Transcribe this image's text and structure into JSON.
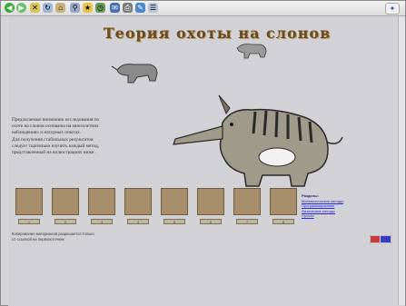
{
  "toolbar": {
    "icons": [
      "back-icon",
      "forward-icon",
      "stop-icon",
      "refresh-icon",
      "home-icon",
      "search-icon",
      "favorites-icon",
      "history-icon",
      "mail-icon",
      "print-icon",
      "edit-icon",
      "discuss-icon",
      "browser-logo-icon"
    ]
  },
  "page": {
    "title": "Теория охоты на слонов",
    "paragraph": [
      "Предлагаемые вниманию исследования по",
      "охоте на слонов основаны на многолетних",
      "наблюдениях и натурных опытах.",
      "Для получения стабильных результатов",
      "следует тщательно изучить каждый метод,",
      "представленный на иллюстрациях ниже."
    ],
    "thumbnails": [
      {
        "caption": "1"
      },
      {
        "caption": "2"
      },
      {
        "caption": "3"
      },
      {
        "caption": "4"
      },
      {
        "caption": "5"
      },
      {
        "caption": "6"
      },
      {
        "caption": "7"
      },
      {
        "caption": "8"
      }
    ],
    "links": {
      "heading": "Разделы:",
      "items": [
        "Математические методы",
        "Программирование",
        "Физические методы",
        "Прочее"
      ]
    },
    "footer": [
      "Копирование материалов разрешается только",
      "со ссылкой на первоисточник"
    ]
  },
  "colors": {
    "accent_title": "#6b4a1e",
    "link": "#2a2ad8",
    "background": "#d2d2d6"
  }
}
